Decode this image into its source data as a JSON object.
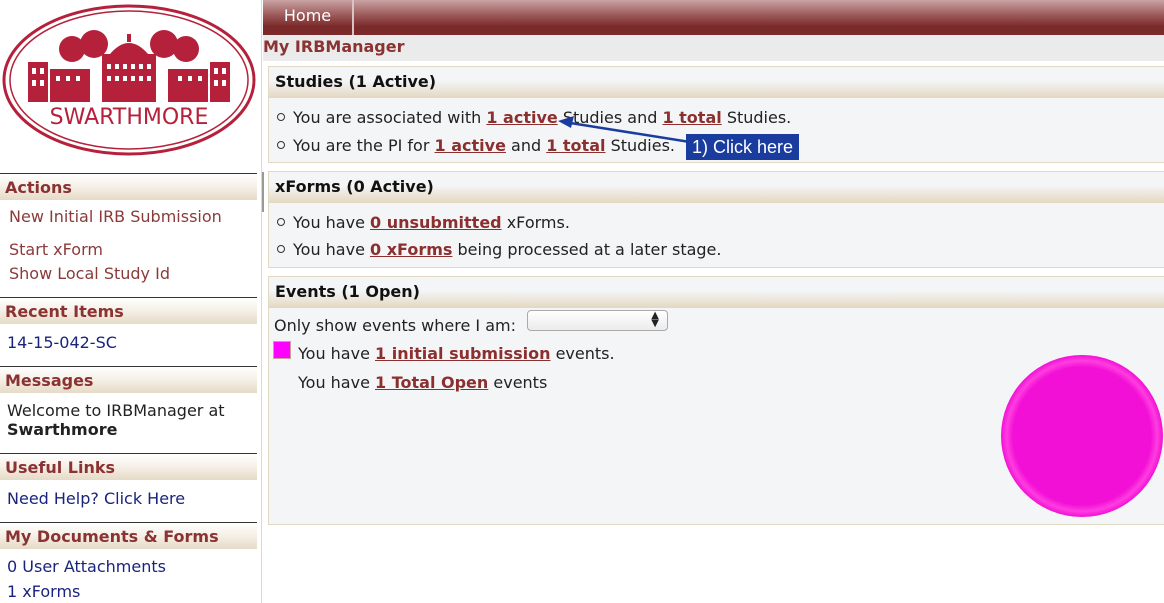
{
  "logo": {
    "text": "SWARTHMORE",
    "color": "#b5213b"
  },
  "topnav": {
    "home_label": "Home"
  },
  "header": {
    "title": "My IRBManager"
  },
  "sidebar": {
    "actions": {
      "title": "Actions",
      "items": [
        "New Initial IRB Submission",
        "Start xForm",
        "Show Local Study Id"
      ]
    },
    "recent_items": {
      "title": "Recent Items",
      "items": [
        "14-15-042-SC"
      ]
    },
    "messages": {
      "title": "Messages",
      "text": "Welcome to IRBManager at",
      "bold": "Swarthmore"
    },
    "useful_links": {
      "title": "Useful Links",
      "items": [
        "Need Help? Click Here"
      ]
    },
    "documents": {
      "title": "My Documents & Forms",
      "items": [
        "0 User Attachments",
        "1 xForms"
      ]
    }
  },
  "studies": {
    "title": "Studies (1 Active)",
    "line1": {
      "pre": "You are associated with ",
      "link1": "1 active",
      "mid": " Studies and ",
      "link2": "1 total",
      "post": " Studies."
    },
    "line2": {
      "pre": "You are the PI for ",
      "link1": "1 active",
      "mid": " and ",
      "link2": "1 total",
      "post": " Studies."
    }
  },
  "annotation": {
    "label": "1) Click here",
    "color": "#1a3c9e"
  },
  "xforms": {
    "title": "xForms (0 Active)",
    "line1": {
      "pre": "You have ",
      "link": "0 unsubmitted",
      "post": " xForms."
    },
    "line2": {
      "pre": "You have ",
      "link": "0 xForms",
      "post": " being processed at a later stage."
    }
  },
  "events": {
    "title": "Events (1 Open)",
    "filter_label": "Only show events where I am:",
    "filter_value": "",
    "line1": {
      "pre": "You have ",
      "link": "1 initial submission",
      "post": " events."
    },
    "line2": {
      "pre": "You have ",
      "link": "1 Total Open",
      "post": " events"
    }
  },
  "chart_data": {
    "type": "pie",
    "title": "",
    "categories": [
      "initial submission"
    ],
    "values": [
      1
    ],
    "colors": [
      "#f20fd6"
    ],
    "legend": "left"
  }
}
